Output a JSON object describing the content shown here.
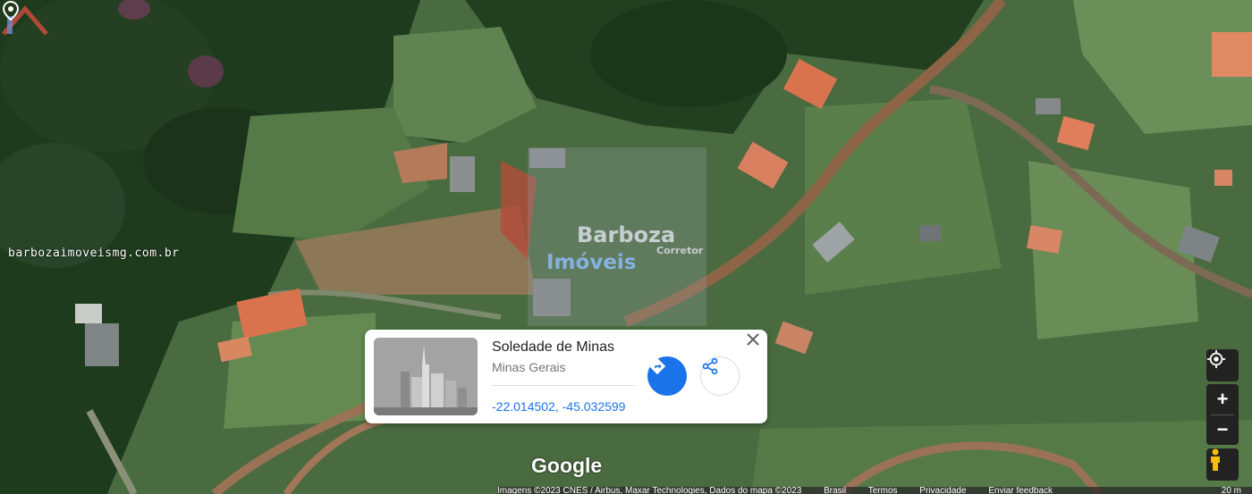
{
  "watermark": {
    "site": "barbozaimoveismg.com.br",
    "brand": "Barboza",
    "sub": "Imóveis",
    "tag": "Corretor"
  },
  "place_card": {
    "title": "Soledade de Minas",
    "subtitle": "Minas Gerais",
    "coordinates": "-22.014502, -45.032599",
    "thumbnail_icon": "city-buildings-icon",
    "directions_icon": "directions-icon",
    "share_icon": "share-icon",
    "close_icon": "close-icon"
  },
  "map": {
    "logo": "Google",
    "pin_icon": "map-pin-icon",
    "controls": {
      "locate_icon": "my-location-icon",
      "zoom_in": "+",
      "zoom_out": "−",
      "pegman_icon": "pegman-icon"
    },
    "footer": {
      "attribution": "Imagens ©2023 CNES / Airbus, Maxar Technologies, Dados do mapa ©2023",
      "brazil": "Brasil",
      "terms": "Termos",
      "privacy": "Privacidade",
      "feedback": "Enviar feedback",
      "scale": "20 m"
    }
  },
  "colors": {
    "accent": "#1a73e8",
    "roof": "#d9734e"
  }
}
